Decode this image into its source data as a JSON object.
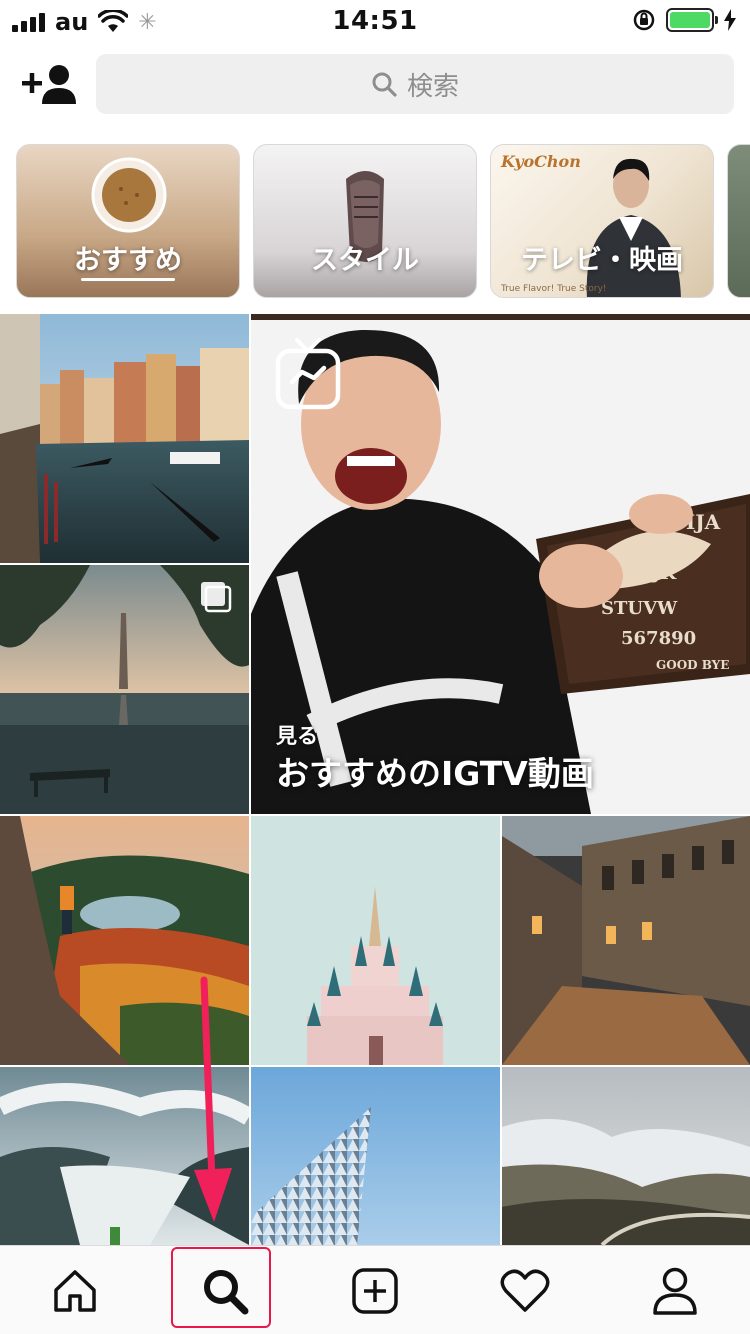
{
  "status_bar": {
    "carrier": "au",
    "time": "14:51"
  },
  "header": {
    "search_placeholder": "検索"
  },
  "topics": [
    {
      "label": "おすすめ",
      "selected": true
    },
    {
      "label": "スタイル",
      "selected": false
    },
    {
      "label": "テレビ・映画",
      "selected": false
    }
  ],
  "igtv": {
    "sub": "見る",
    "title": "おすすめのIGTV動画"
  },
  "annotation_color": "#e8174c",
  "tabs": [
    "home-icon",
    "search-icon",
    "add-post-icon",
    "heart-icon",
    "profile-icon"
  ]
}
